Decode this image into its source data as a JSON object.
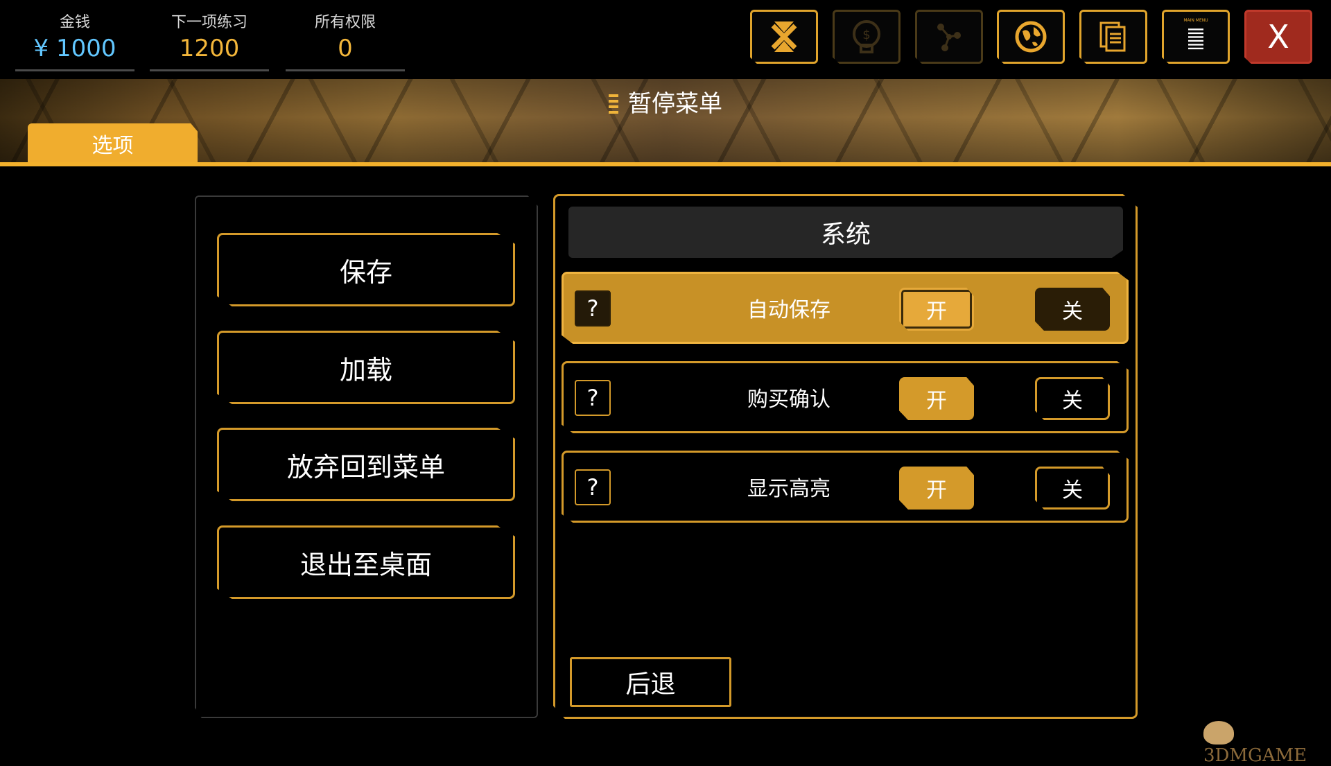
{
  "stats": [
    {
      "label": "金钱",
      "value": "¥ 1000"
    },
    {
      "label": "下一项练习",
      "value": "1200"
    },
    {
      "label": "所有权限",
      "value": "0"
    }
  ],
  "toolbar": {
    "icons": [
      "augmentation-icon",
      "skull-money-icon",
      "network-icon",
      "globe-map-icon",
      "documents-icon",
      "main-menu-icon",
      "close-icon"
    ],
    "main_menu_caption": "MAIN MENU",
    "close_label": "X"
  },
  "banner": {
    "title": "暂停菜单",
    "tab_label": "选项"
  },
  "menu": {
    "buttons": [
      "保存",
      "加载",
      "放弃回到菜单",
      "退出至桌面"
    ]
  },
  "system": {
    "header": "系统",
    "options": [
      {
        "label": "自动保存",
        "on": "开",
        "off": "关",
        "help": "?",
        "selected": "off",
        "highlighted": true
      },
      {
        "label": "购买确认",
        "on": "开",
        "off": "关",
        "help": "?",
        "selected": "on",
        "highlighted": false
      },
      {
        "label": "显示高亮",
        "on": "开",
        "off": "关",
        "help": "?",
        "selected": "on",
        "highlighted": false
      }
    ],
    "back_label": "后退"
  },
  "colors": {
    "accent": "#d49a2a",
    "money": "#62c7ff",
    "close": "#a02a1e"
  },
  "watermark": "3DMGAME"
}
